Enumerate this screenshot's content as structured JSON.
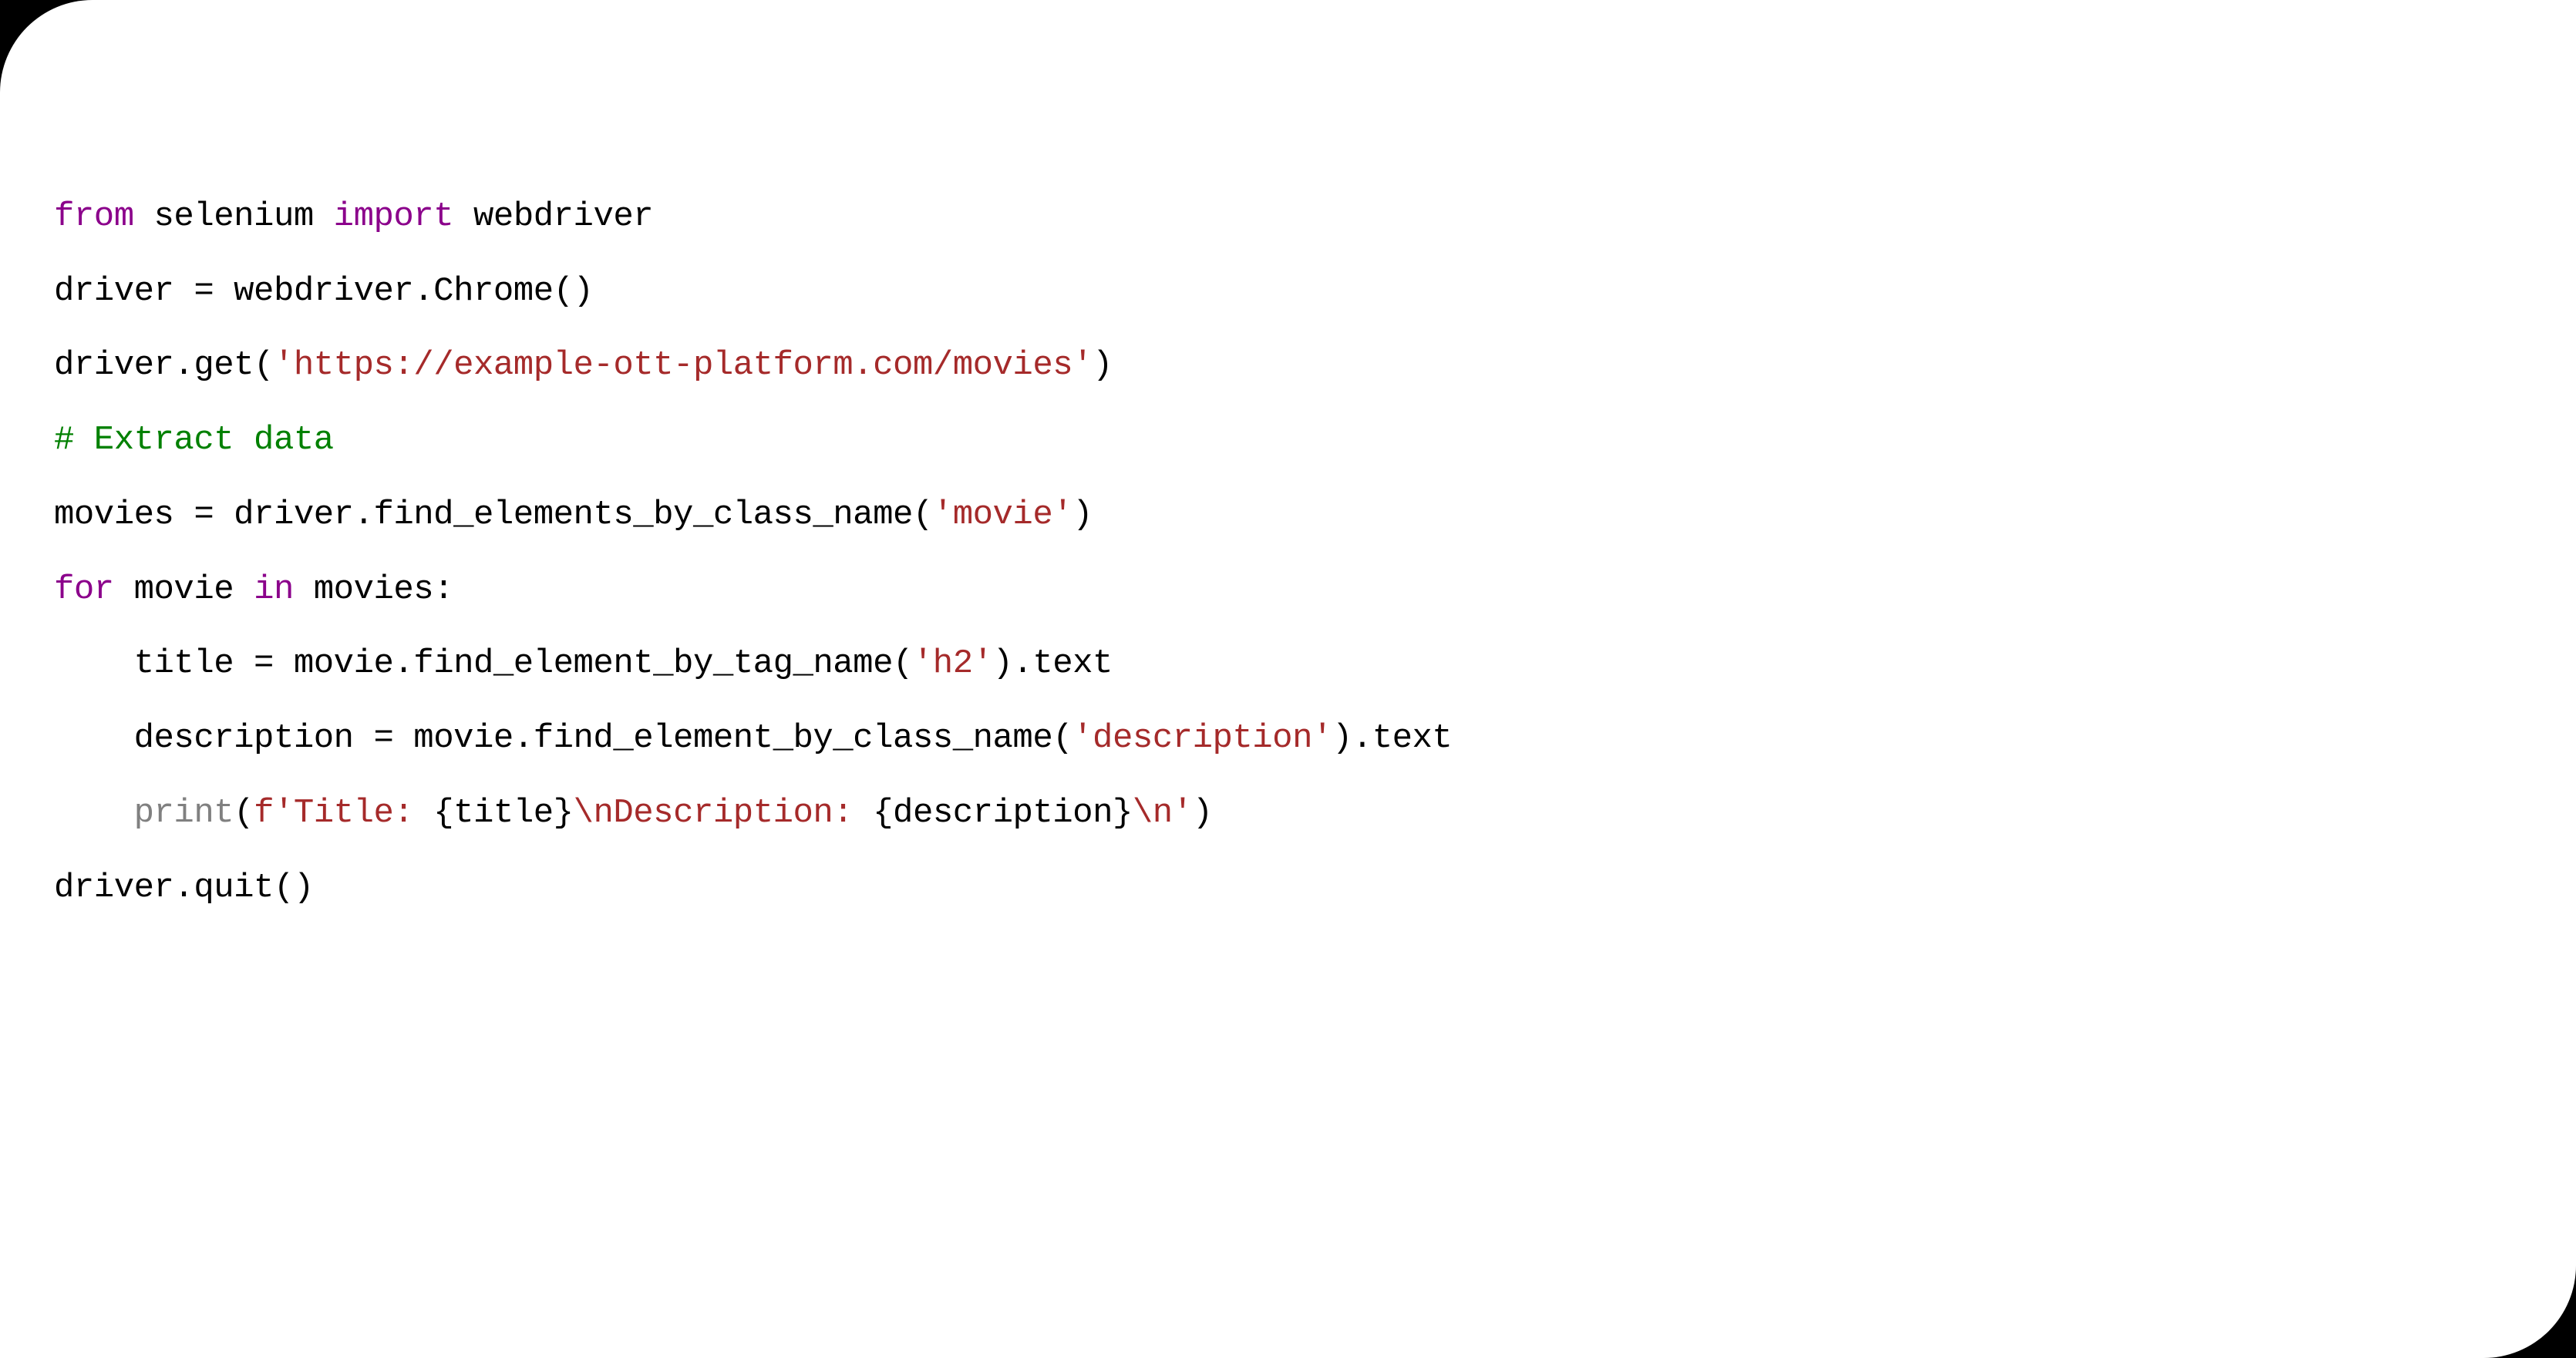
{
  "code": {
    "line1": {
      "kw_from": "from",
      "sp1": " ",
      "mod": "selenium",
      "sp2": " ",
      "kw_import": "import",
      "sp3": " ",
      "name": "webdriver"
    },
    "line2": {
      "text": "driver = webdriver.Chrome()"
    },
    "line3": {
      "pre": "driver.get(",
      "str": "'https://example-ott-platform.com/movies'",
      "post": ")"
    },
    "line4": {
      "comment": "# Extract data"
    },
    "line5": {
      "pre": "movies = driver.find_elements_by_class_name(",
      "str": "'movie'",
      "post": ")"
    },
    "line6": {
      "kw_for": "for",
      "sp1": " ",
      "var": "movie",
      "sp2": " ",
      "kw_in": "in",
      "sp3": " ",
      "iter": "movies:"
    },
    "line7": {
      "indent": "    ",
      "pre": "title = movie.find_element_by_tag_name(",
      "str": "'h2'",
      "post": ").text"
    },
    "line8": {
      "indent": "    ",
      "pre": "description = movie.find_element_by_class_name(",
      "str": "'description'",
      "post": ").text"
    },
    "line9": {
      "indent": "    ",
      "builtin": "print",
      "open": "(",
      "fprefix": "f",
      "q1": "'",
      "s1": "Title: ",
      "b1o": "{",
      "v1": "title",
      "b1c": "}",
      "esc1": "\\n",
      "s2": "Description: ",
      "b2o": "{",
      "v2": "description",
      "b2c": "}",
      "esc2": "\\n",
      "q2": "'",
      "close": ")"
    },
    "line10": {
      "text": "driver.quit()"
    }
  }
}
